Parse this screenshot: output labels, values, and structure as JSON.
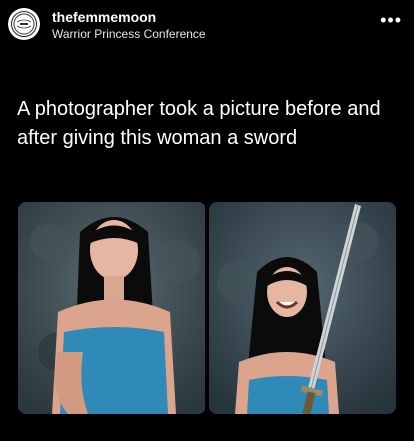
{
  "post": {
    "username": "thefemmemoon",
    "subtitle": "Warrior Princess Conference",
    "more_icon": "•••",
    "avatar_label": "The Femme Moon",
    "caption": "A photographer took a picture before and after giving this woman a sword"
  },
  "images": {
    "before": {
      "description": "woman posing seriously"
    },
    "after": {
      "description": "woman smiling holding sword"
    }
  },
  "colors": {
    "background": "#000000",
    "top_color": "#2f8ab8",
    "backdrop": "#3a4a52"
  }
}
